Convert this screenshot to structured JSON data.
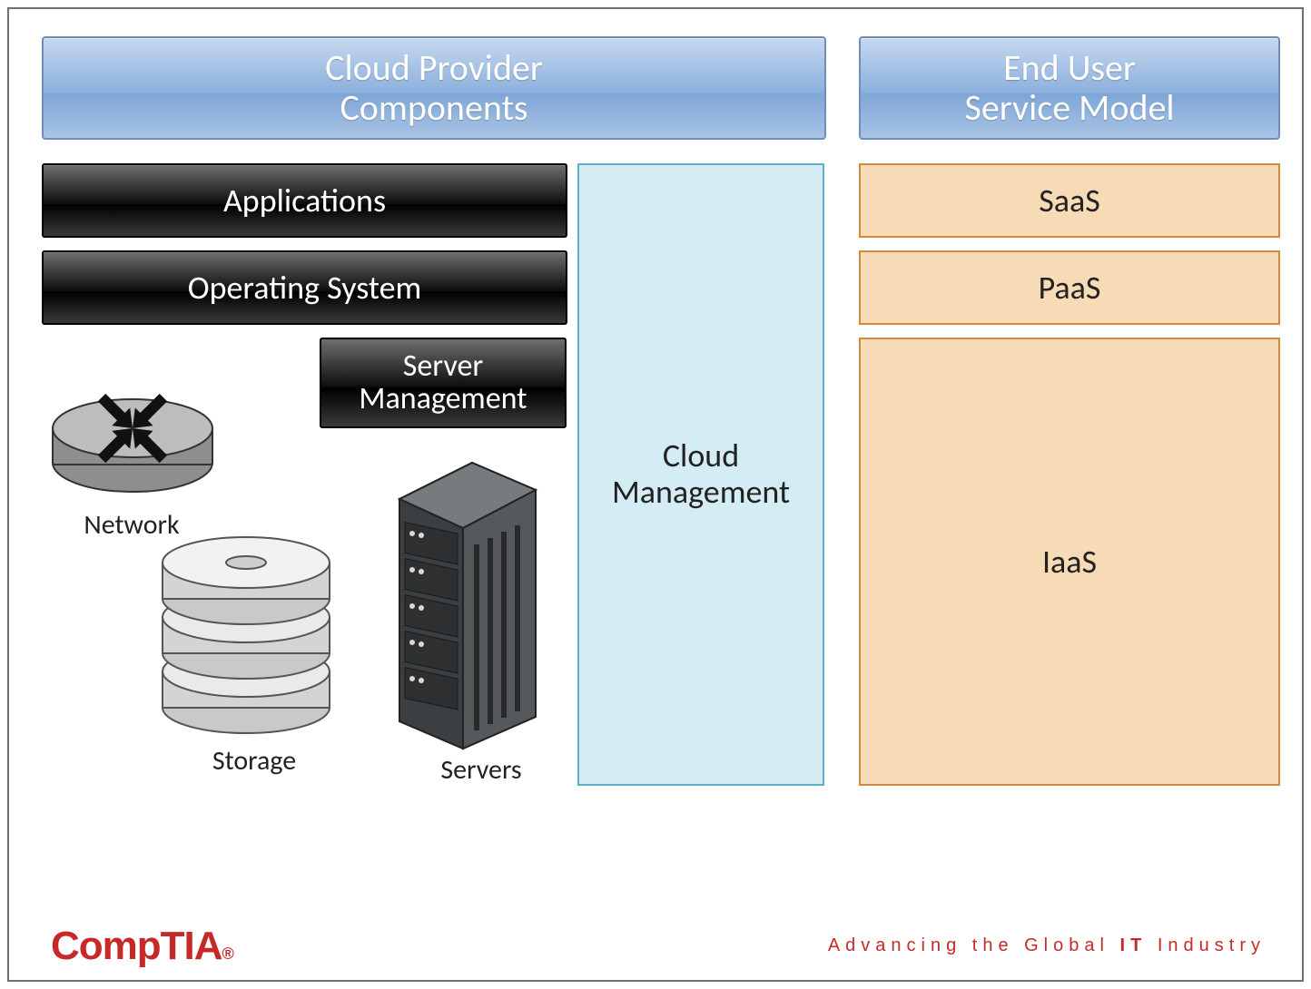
{
  "headers": {
    "components": "Cloud Provider\nComponents",
    "service_model": "End User\nService Model"
  },
  "layers": {
    "applications": "Applications",
    "operating_system": "Operating System",
    "server_management": "Server\nManagement",
    "cloud_management": "Cloud\nManagement"
  },
  "infrastructure": {
    "network": "Network",
    "storage": "Storage",
    "servers": "Servers"
  },
  "service_models": {
    "saas": "SaaS",
    "paas": "PaaS",
    "iaas": "IaaS"
  },
  "footer": {
    "logo": "CompTIA",
    "tagline_prefix": "Advancing the Gl",
    "tagline_mid": "o",
    "tagline_suffix": "bal ",
    "tagline_bold": "IT",
    "tagline_end": " Industry"
  }
}
